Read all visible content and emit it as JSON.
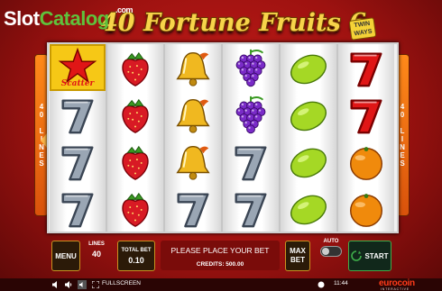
{
  "watermark": {
    "slot": "Slot",
    "catalog": "Catalog",
    "com": ".com"
  },
  "game": {
    "title": "40 Fortune Fruits 6",
    "badge_line1": "TWIN",
    "badge_line2": "WAYS"
  },
  "side_tabs": {
    "left": [
      "4",
      "0",
      "",
      "L",
      "I",
      "N",
      "E",
      "S"
    ],
    "right": [
      "4",
      "0",
      "",
      "L",
      "I",
      "N",
      "E",
      "S"
    ]
  },
  "reels": [
    [
      "scatter",
      "seven",
      "seven",
      "seven"
    ],
    [
      "strawberry",
      "strawberry",
      "strawberry",
      "strawberry"
    ],
    [
      "bell",
      "bell",
      "bell",
      "seven"
    ],
    [
      "grapes",
      "grapes",
      "seven",
      "seven"
    ],
    [
      "lemon",
      "lemon",
      "lemon",
      "lemon"
    ],
    [
      "seven",
      "seven",
      "orange",
      "orange"
    ]
  ],
  "symbols": {
    "scatter_label": "Scatter"
  },
  "colors": {
    "seven_red": "#e01616",
    "seven_silver": "#9aa6b4",
    "strawberry": "#d81a24",
    "bell": "#f0b820",
    "grapes": "#7a2bc8",
    "lemon": "#a5d825",
    "orange": "#f08a0c",
    "accent_gold": "#c99220",
    "start_green": "#3fae4a"
  },
  "controls": {
    "menu": "MENU",
    "lines_label": "LINES",
    "lines_value": "40",
    "total_bet_label": "TOTAL BET",
    "total_bet_value": "0.10",
    "message": "PLEASE PLACE YOUR BET",
    "credits": "CREDITS: 500.00",
    "max_bet": "MAX BET",
    "auto": "AUTO",
    "start": "START"
  },
  "bottom_bar": {
    "fullscreen": "FULLSCREEN",
    "time": "11:44",
    "brand": "eurocoin",
    "brand_sub": "INTERACTIVE"
  }
}
